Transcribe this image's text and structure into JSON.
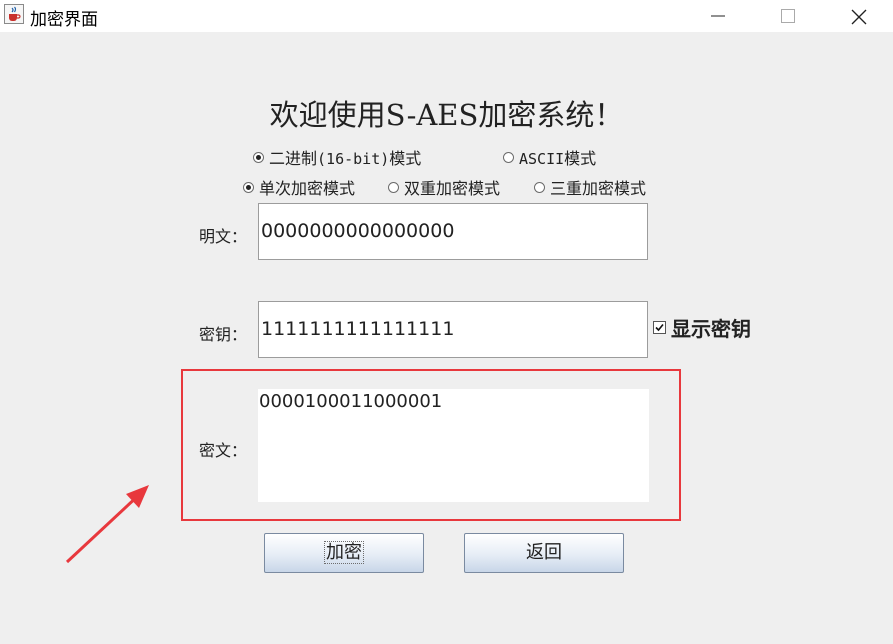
{
  "window": {
    "title": "加密界面",
    "app_icon": "java-cup-icon",
    "controls": [
      "minimize-icon",
      "maximize-icon",
      "close-icon"
    ]
  },
  "heading": "欢迎使用S-AES加密系统！",
  "data_mode": {
    "options": [
      {
        "label_cn": "二进制",
        "label_code": "(16-bit)",
        "label_suffix": "模式",
        "selected": true
      },
      {
        "label_code": "ASCII",
        "label_suffix": "模式",
        "selected": false
      }
    ]
  },
  "encrypt_mode": {
    "options": [
      {
        "label": "单次加密模式",
        "selected": true
      },
      {
        "label": "双重加密模式",
        "selected": false
      },
      {
        "label": "三重加密模式",
        "selected": false
      }
    ]
  },
  "plaintext": {
    "label": "明文：",
    "value": "0000000000000000"
  },
  "key": {
    "label": "密钥：",
    "value": "1111111111111111"
  },
  "show_key": {
    "label": "显示密钥",
    "checked": true
  },
  "ciphertext": {
    "label": "密文：",
    "value": "0000100011000001"
  },
  "buttons": {
    "encrypt": "加密",
    "back": "返回"
  },
  "annotation": {
    "box_color": "#e8383d",
    "arrow_color": "#e8383d"
  }
}
